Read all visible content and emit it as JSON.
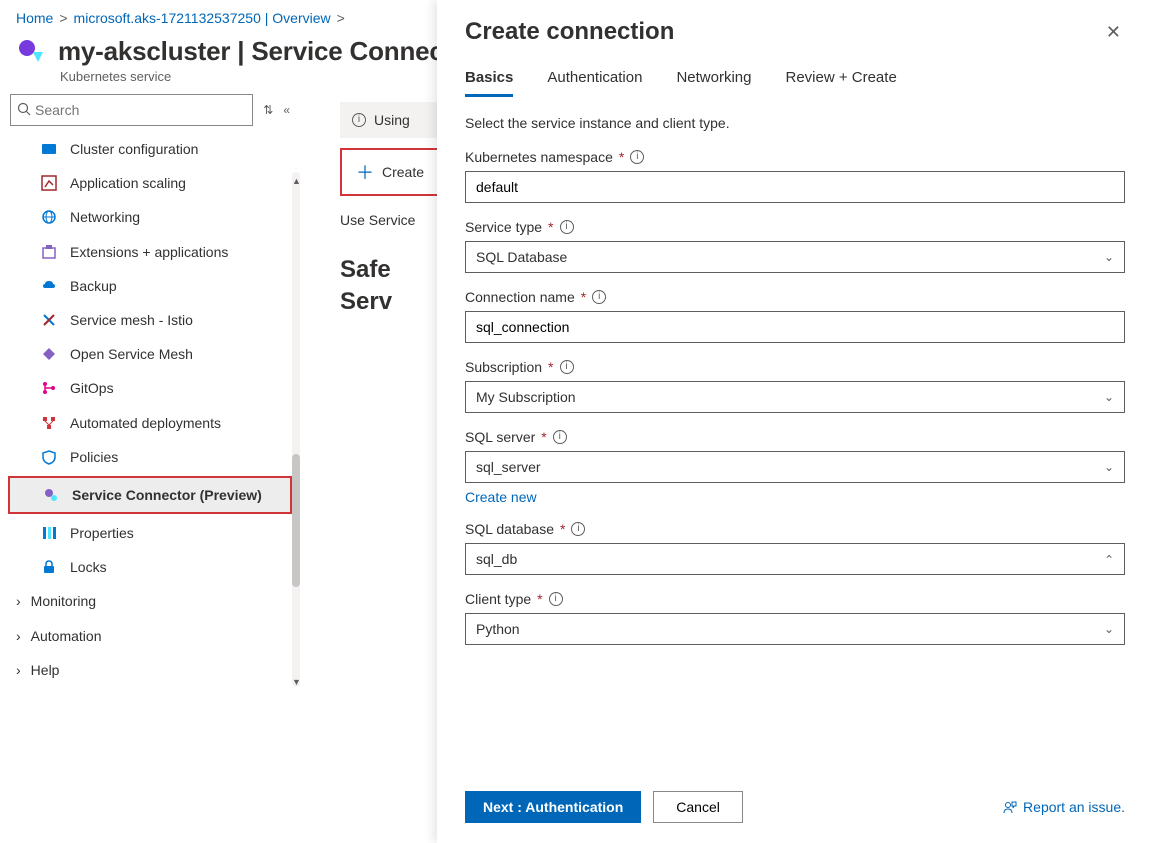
{
  "breadcrumb": {
    "items": [
      "Home",
      "microsoft.aks-1721132537250 | Overview"
    ],
    "sep": ">"
  },
  "header": {
    "title": "my-akscluster | Service Connector",
    "subtitle": "Kubernetes service"
  },
  "sidebar": {
    "search_placeholder": "Search",
    "items": [
      {
        "label": "Cluster configuration",
        "icon": "config-icon"
      },
      {
        "label": "Application scaling",
        "icon": "scale-icon"
      },
      {
        "label": "Networking",
        "icon": "network-icon"
      },
      {
        "label": "Extensions + applications",
        "icon": "extensions-icon"
      },
      {
        "label": "Backup",
        "icon": "backup-icon"
      },
      {
        "label": "Service mesh - Istio",
        "icon": "istio-icon"
      },
      {
        "label": "Open Service Mesh",
        "icon": "osm-icon"
      },
      {
        "label": "GitOps",
        "icon": "gitops-icon"
      },
      {
        "label": "Automated deployments",
        "icon": "deploy-icon"
      },
      {
        "label": "Policies",
        "icon": "policies-icon"
      },
      {
        "label": "Service Connector (Preview)",
        "icon": "connector-icon",
        "selected": true
      },
      {
        "label": "Properties",
        "icon": "props-icon"
      },
      {
        "label": "Locks",
        "icon": "locks-icon"
      }
    ],
    "groups": [
      "Monitoring",
      "Automation",
      "Help"
    ]
  },
  "main": {
    "info_text": "Using",
    "create_btn": "Create",
    "use_sc": "Use Service",
    "heading_line1": "Safe",
    "heading_line2": "Serv"
  },
  "panel": {
    "title": "Create connection",
    "tabs": [
      "Basics",
      "Authentication",
      "Networking",
      "Review + Create"
    ],
    "active_tab": 0,
    "instruction": "Select the service instance and client type.",
    "fields": {
      "k8s_namespace": {
        "label": "Kubernetes namespace",
        "value": "default"
      },
      "service_type": {
        "label": "Service type",
        "value": "SQL Database"
      },
      "connection_name": {
        "label": "Connection name",
        "value": "sql_connection"
      },
      "subscription": {
        "label": "Subscription",
        "value": "My Subscription"
      },
      "sql_server": {
        "label": "SQL server",
        "value": "sql_server",
        "create_new": "Create new"
      },
      "sql_database": {
        "label": "SQL database",
        "value": "sql_db"
      },
      "client_type": {
        "label": "Client type",
        "value": "Python"
      }
    },
    "footer": {
      "primary": "Next : Authentication",
      "secondary": "Cancel",
      "report": "Report an issue."
    }
  }
}
